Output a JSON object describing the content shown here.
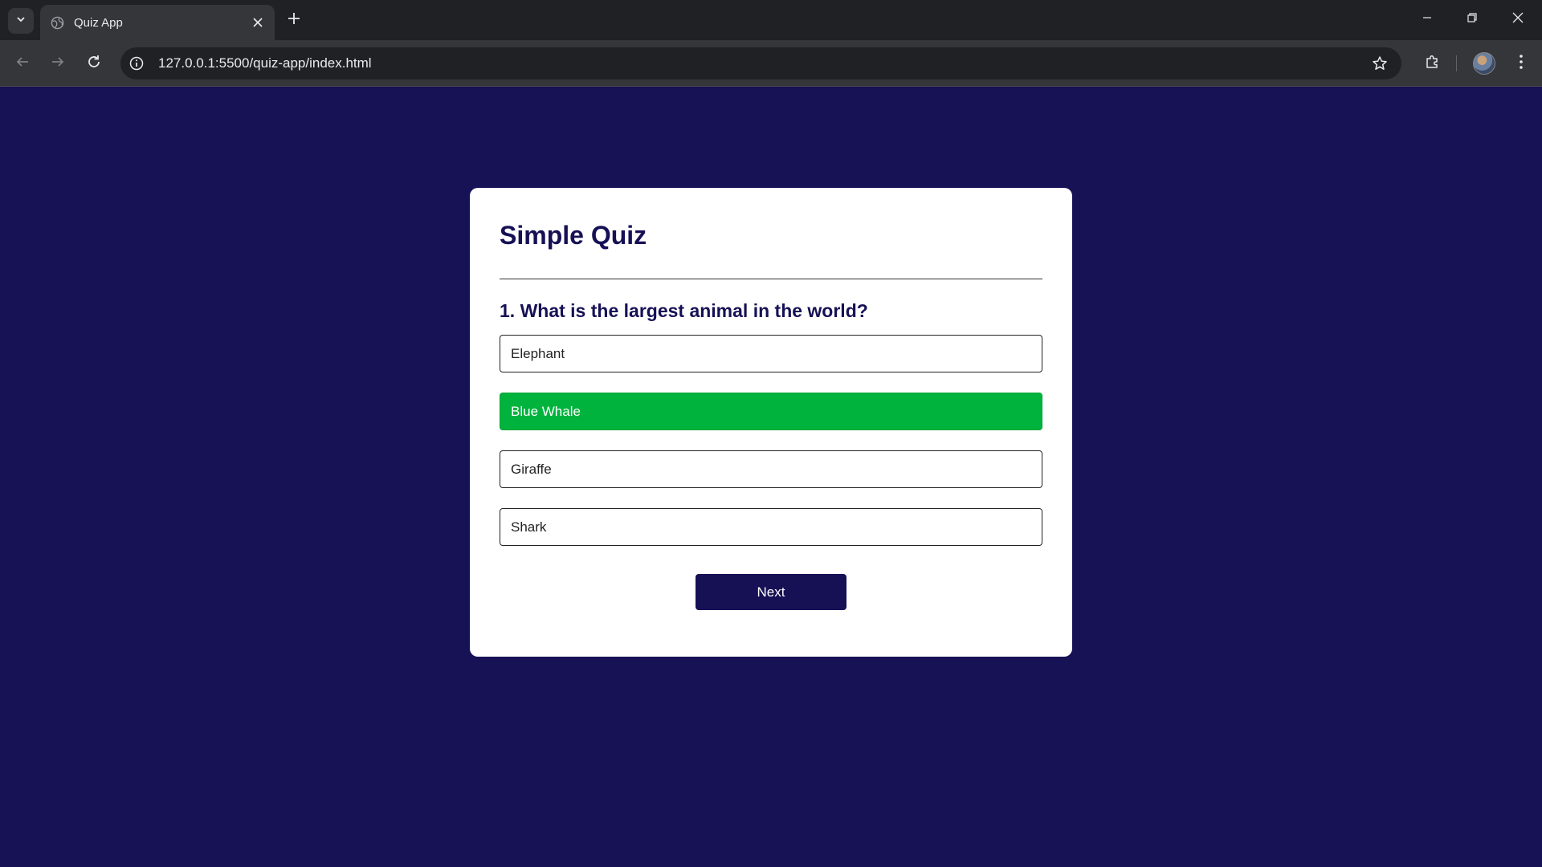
{
  "browser": {
    "tab_title": "Quiz App",
    "url": "127.0.0.1:5500/quiz-app/index.html"
  },
  "quiz": {
    "title": "Simple Quiz",
    "question": "1. What is the largest animal in the world?",
    "answers": [
      {
        "label": "Elephant",
        "state": "default"
      },
      {
        "label": "Blue Whale",
        "state": "correct"
      },
      {
        "label": "Giraffe",
        "state": "default"
      },
      {
        "label": "Shark",
        "state": "default"
      }
    ],
    "next_label": "Next"
  },
  "colors": {
    "page_background": "#171156",
    "heading": "#161155",
    "correct": "#00b33c",
    "button": "#161155"
  }
}
